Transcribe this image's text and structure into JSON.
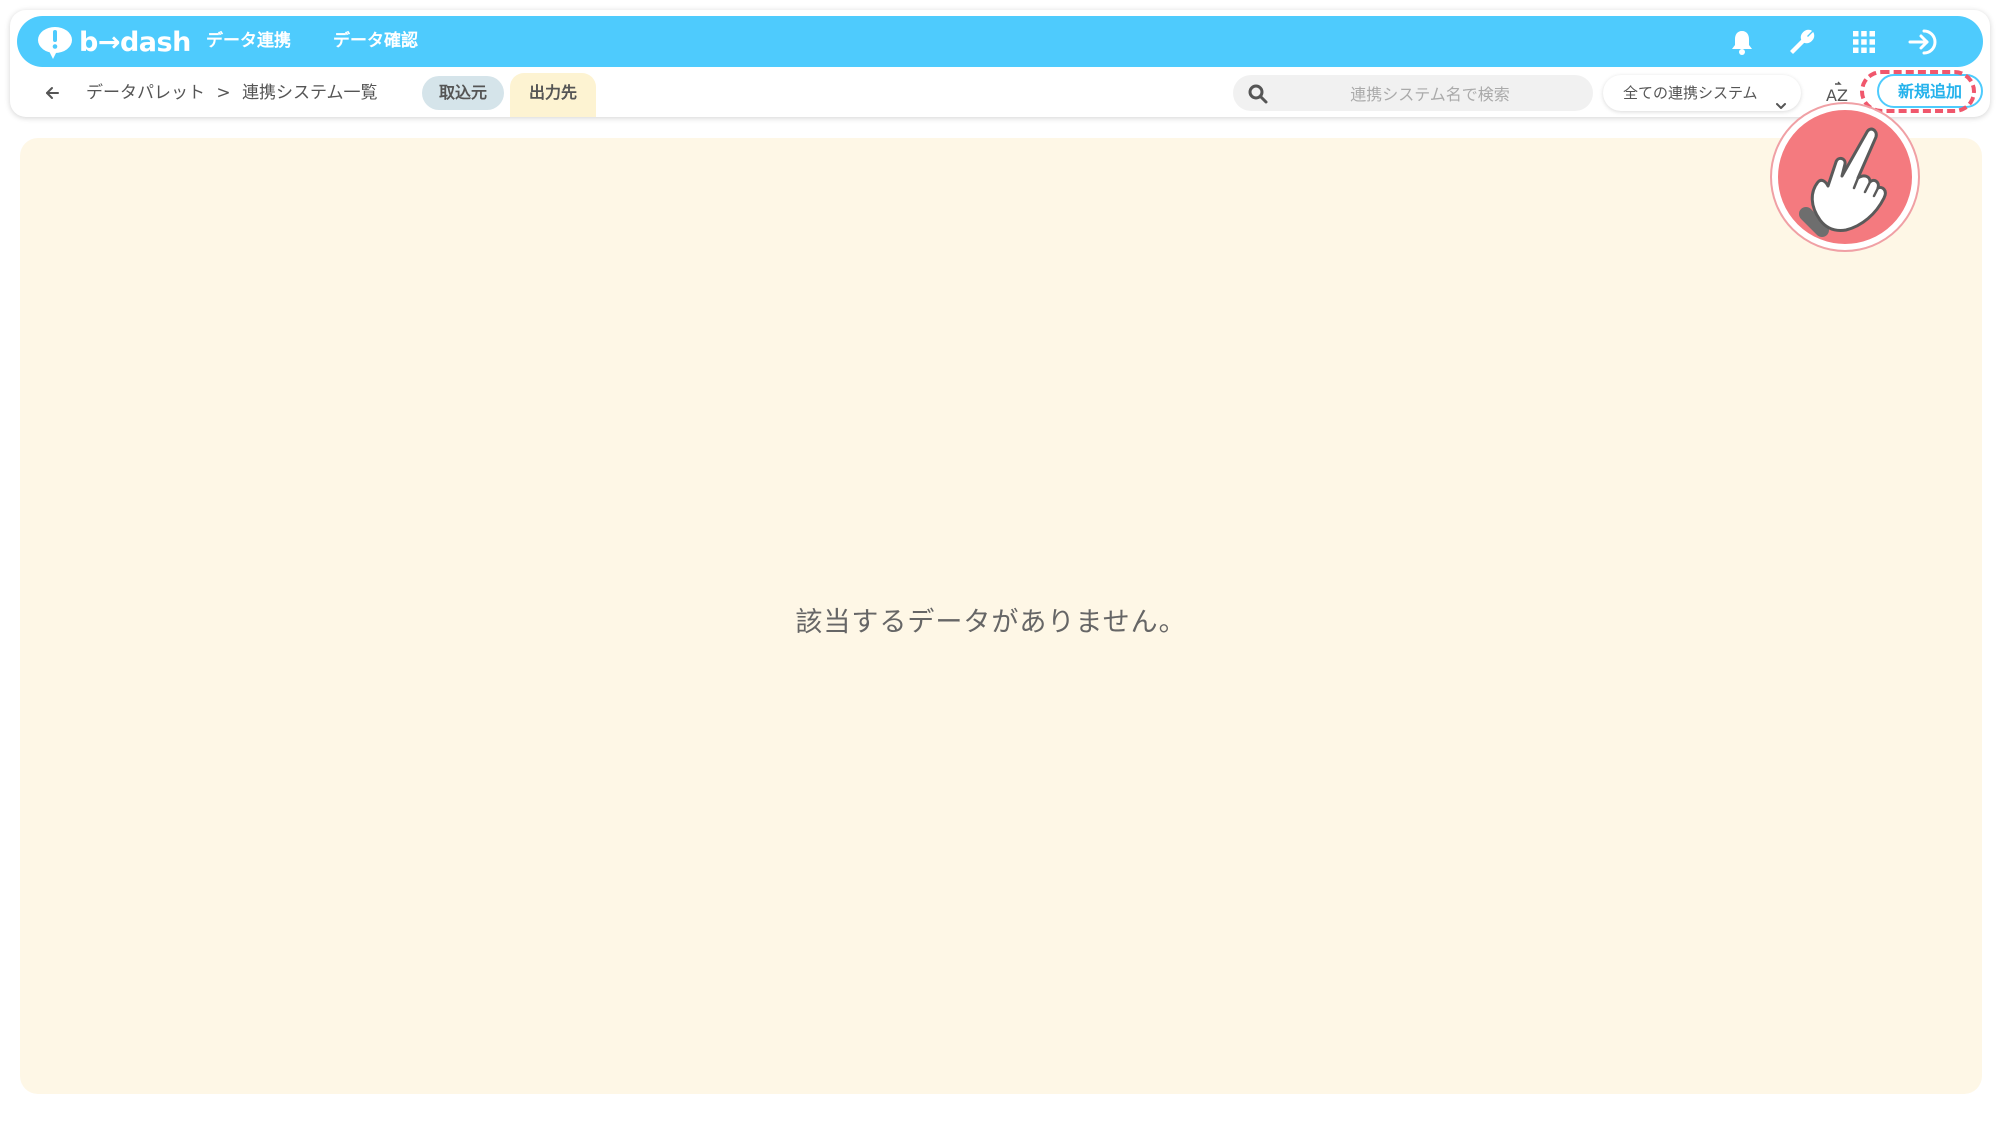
{
  "app": {
    "logo_text": "b→dash",
    "brand_color": "#4ecbfd",
    "accent_color": "#f0576c"
  },
  "topbar": {
    "nav": [
      {
        "label": "データ連携"
      },
      {
        "label": "データ確認"
      }
    ],
    "icons": [
      "bell-icon",
      "wrench-icon",
      "grid-apps-icon",
      "logout-icon"
    ]
  },
  "subbar": {
    "breadcrumb": {
      "parent": "データパレット",
      "separator": ">",
      "current": "連携システム一覧"
    },
    "tabs": {
      "import": "取込元",
      "export": "出力先"
    },
    "search": {
      "placeholder": "連携システム名で検索",
      "value": ""
    },
    "filter": {
      "selected": "全ての連携システム"
    },
    "sort_label": "AZ",
    "add_button": "新規追加"
  },
  "main": {
    "empty_message": "該当するデータがありません。"
  }
}
